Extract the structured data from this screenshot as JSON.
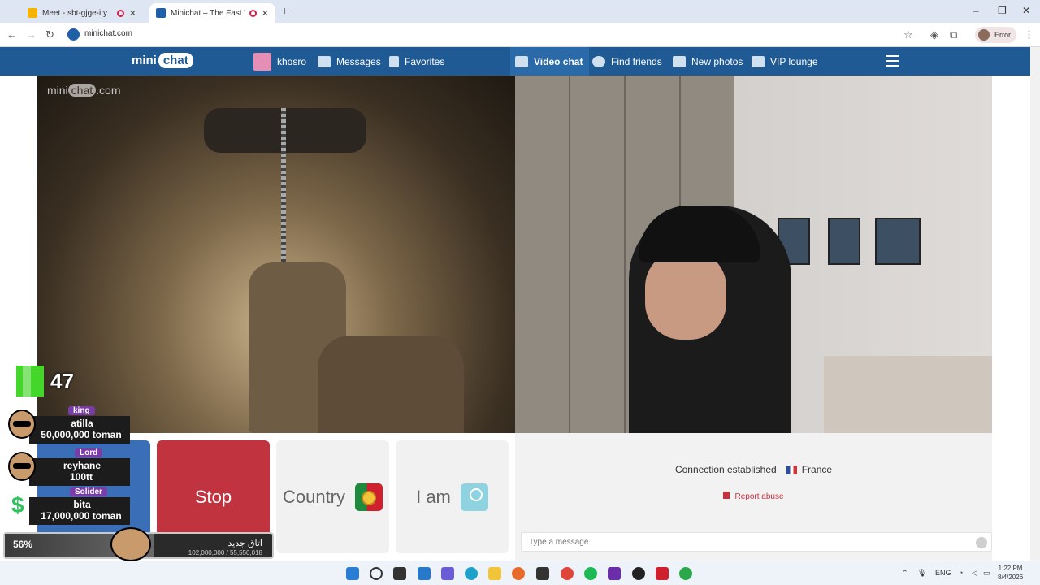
{
  "browser": {
    "tabs": [
      {
        "label": "Meet - sbt-gjge-ity",
        "color": "#f5b400"
      },
      {
        "label": "Minichat – The Fast Video C",
        "color": "#1f5fa8"
      }
    ],
    "new_tab": "+",
    "url": "minichat.com",
    "profile_label": "Error",
    "window_controls": [
      "–",
      "❐",
      "✕"
    ]
  },
  "site_nav": {
    "logo_left": "mini",
    "logo_right": "chat",
    "user": "khosro",
    "messages": "Messages",
    "favorites": "Favorites",
    "video_chat": "Video chat",
    "find_friends": "Find friends",
    "new_photos": "New photos",
    "vip_lounge": "VIP lounge"
  },
  "video": {
    "watermark_left": "mini",
    "watermark_mid": "chat",
    "watermark_right": ".com"
  },
  "controls": {
    "stop": "Stop",
    "country": "Country",
    "iam": "I am"
  },
  "chat": {
    "connection": "Connection established",
    "country": "France",
    "report": "Report abuse",
    "placeholder": "Type a message"
  },
  "overlay": {
    "k_count": "47",
    "donors": [
      {
        "rank": "king",
        "name": "atilla",
        "amount": "50,000,000 toman"
      },
      {
        "rank": "Lord",
        "name": "reyhane",
        "amount": "100tt"
      },
      {
        "rank": "Solider",
        "name": "bita",
        "amount": "17,000,000 toman"
      }
    ],
    "goal": {
      "percent_label": "56%",
      "fraction": 0.56,
      "title": "اتاق جدید",
      "amount": "102,000,000 / 55,550,018"
    }
  },
  "taskbar": {
    "tray_lang": "ENG",
    "time": "1:22 PM",
    "date": "8/4/2026"
  },
  "colors": {
    "nav": "#1f5a94",
    "stop": "#c0333f",
    "start": "#3a6fb8"
  }
}
